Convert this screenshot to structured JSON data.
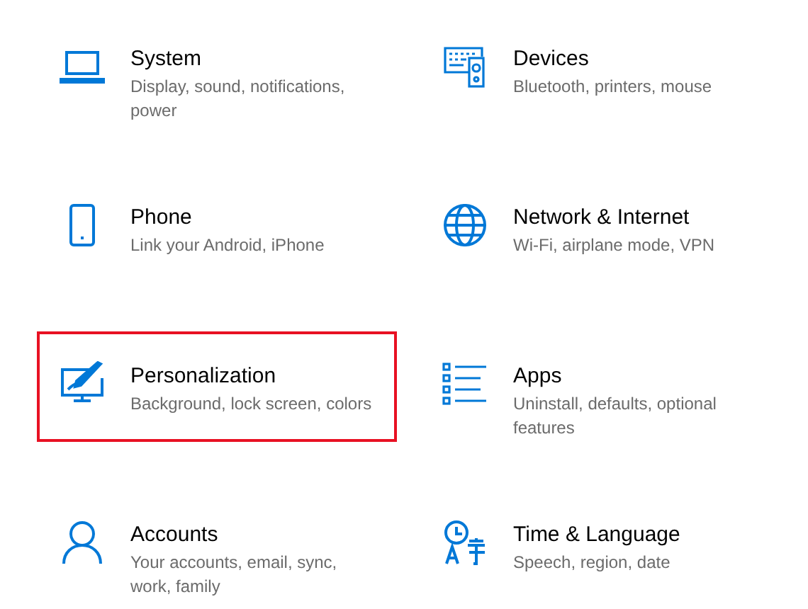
{
  "categories": [
    {
      "title": "System",
      "description": "Display, sound, notifications, power",
      "highlighted": false
    },
    {
      "title": "Devices",
      "description": "Bluetooth, printers, mouse",
      "highlighted": false
    },
    {
      "title": "Phone",
      "description": "Link your Android, iPhone",
      "highlighted": false
    },
    {
      "title": "Network & Internet",
      "description": "Wi-Fi, airplane mode, VPN",
      "highlighted": false
    },
    {
      "title": "Personalization",
      "description": "Background, lock screen, colors",
      "highlighted": true
    },
    {
      "title": "Apps",
      "description": "Uninstall, defaults, optional features",
      "highlighted": false
    },
    {
      "title": "Accounts",
      "description": "Your accounts, email, sync, work, family",
      "highlighted": false
    },
    {
      "title": "Time & Language",
      "description": "Speech, region, date",
      "highlighted": false
    }
  ]
}
